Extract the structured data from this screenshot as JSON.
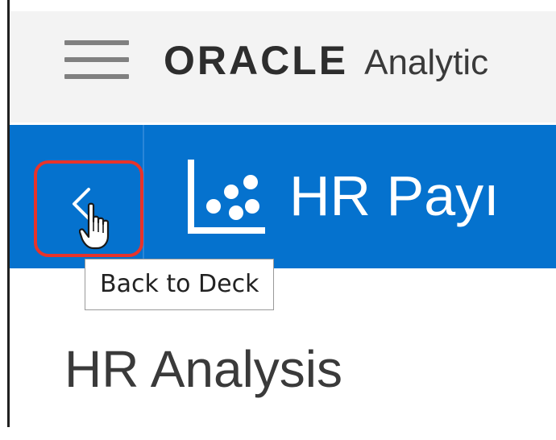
{
  "header": {
    "brand": "ORACLE",
    "product": "Analytic",
    "menu_icon": "hamburger-menu-icon"
  },
  "project_bar": {
    "back_button": {
      "icon": "chevron-left-icon",
      "tooltip": "Back to Deck",
      "highlight_color": "#e8332a"
    },
    "project_icon": "visualization-icon",
    "title": "HR Payı"
  },
  "main": {
    "title": "HR Analysis"
  },
  "colors": {
    "accent": "#0572ce",
    "header_bg": "#f3f3f3"
  }
}
